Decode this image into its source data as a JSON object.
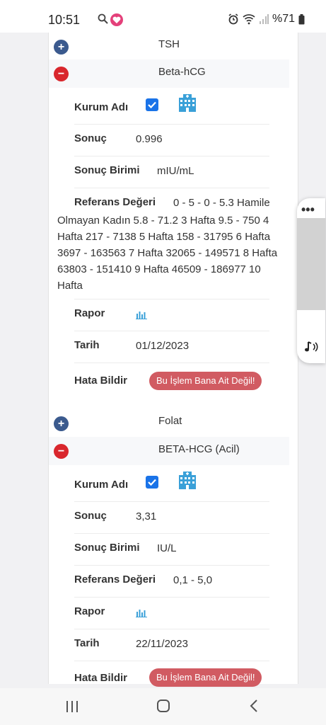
{
  "status_bar": {
    "time": "10:51",
    "battery": "%71"
  },
  "tests": [
    {
      "name": "TSH"
    },
    {
      "name": "Beta-hCG",
      "labels": {
        "institution": "Kurum Adı",
        "result": "Sonuç",
        "unit": "Sonuç Birimi",
        "reference": "Referans Değeri",
        "report": "Rapor",
        "date": "Tarih",
        "report_error": "Hata Bildir"
      },
      "result": "0.996",
      "unit": "mIU/mL",
      "reference_first_line": "0 - 5 - 0 - 5.3 Hamile",
      "reference_rest": "Olmayan Kadın 5.8 - 71.2 3 Hafta 9.5 - 750 4 Hafta 217 - 7138 5 Hafta 158 - 31795 6 Hafta 3697 - 163563 7 Hafta 32065 - 149571 8 Hafta 63803 - 151410 9 Hafta 46509 - 186977 10 Hafta",
      "date": "01/12/2023",
      "error_button": "Bu İşlem Bana Ait Değil!"
    },
    {
      "name": "Folat"
    },
    {
      "name": "BETA-HCG (Acil)",
      "labels": {
        "institution": "Kurum Adı",
        "result": "Sonuç",
        "unit": "Sonuç Birimi",
        "reference": "Referans Değeri",
        "report": "Rapor",
        "date": "Tarih",
        "report_error": "Hata Bildir"
      },
      "result": "3,31",
      "unit": "IU/L",
      "reference": "0,1 - 5,0",
      "date": "22/11/2023",
      "error_button": "Bu İşlem Bana Ait Değil!"
    }
  ],
  "icons": {
    "plus": "plus-circle-icon",
    "minus": "minus-circle-icon",
    "checkbox": "checkbox-checked-icon",
    "building": "hospital-building-icon",
    "report": "bar-chart-icon"
  },
  "colors": {
    "plus": "#3b5a8e",
    "minus": "#d9272d",
    "error_button": "#d15b62",
    "checkbox": "#1a73e8",
    "icon_blue": "#3aa0d8"
  }
}
